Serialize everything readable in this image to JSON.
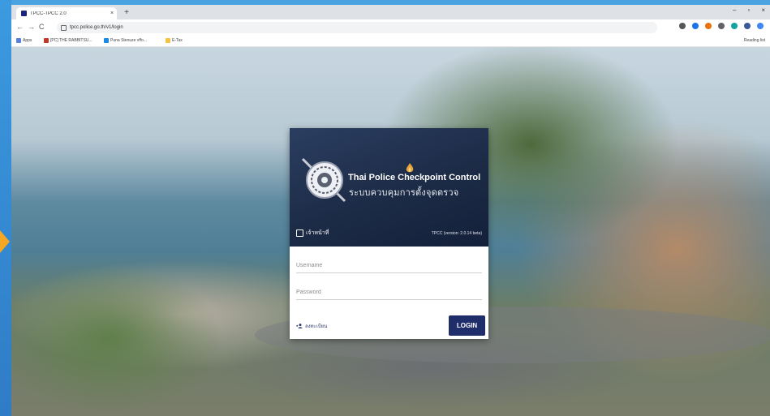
{
  "browser": {
    "tab_title": "TPCC-TPCC 2.0",
    "new_tab_symbol": "+",
    "tab_close_symbol": "×",
    "url": "tpcc.police.go.th/v1/login",
    "window_controls": {
      "minimize": "–",
      "maximize": "▫",
      "close": "×"
    },
    "nav": {
      "back": "←",
      "forward": "→",
      "reload": "C"
    },
    "bookmarks": [
      {
        "label": "Apps",
        "color": "#5b7fd6"
      },
      {
        "label": "[PC] THE RABBITSU...",
        "color": "#c0392b"
      },
      {
        "label": "Puna Stenuze vffo...",
        "color": "#1e88e5"
      },
      {
        "label": "E-Tax",
        "color": "#f6c343"
      }
    ],
    "reading_list": "Reading list",
    "extension_colors": [
      "#555555",
      "#1a73e8",
      "#e8710a",
      "#5f6368",
      "#12a4a0",
      "#3b5998",
      "#4285f4"
    ]
  },
  "card": {
    "title": "Thai Police Checkpoint Control",
    "subtitle": "ระบบควบคุมการตั้งจุดตรวจ",
    "logo_text": "เจ้าหน้าที่",
    "version": "TPCC (version: 2.0.14 beta)",
    "username_placeholder": "Username",
    "password_placeholder": "Password",
    "register_label": "ลงทะเบียน",
    "login_label": "LOGIN"
  },
  "colors": {
    "header_bg": "#1c2b46",
    "login_button": "#1f2d6b",
    "accent_arrow": "#f5a623"
  }
}
